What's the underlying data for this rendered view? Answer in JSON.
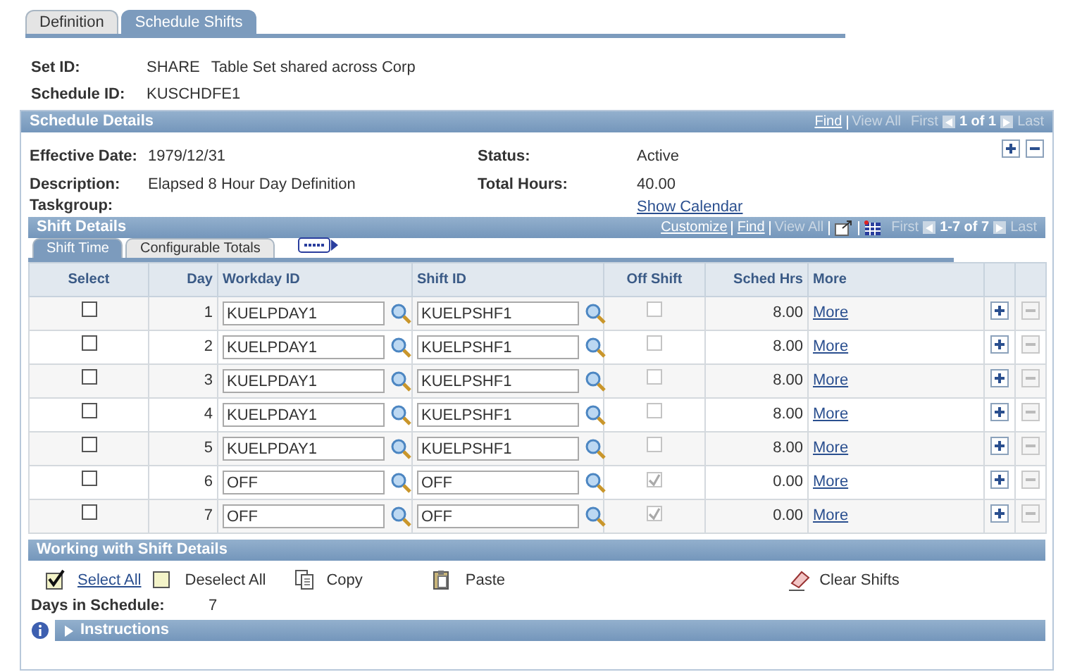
{
  "tabs": [
    {
      "label": "Definition",
      "selected": false
    },
    {
      "label": "Schedule Shifts",
      "selected": true
    }
  ],
  "header": [
    {
      "label": "Set ID:",
      "value": "SHARE",
      "description": "Table Set shared across Corp"
    },
    {
      "label": "Schedule ID:",
      "value": "KUSCHDFE1"
    }
  ],
  "schedule_details": {
    "title": "Schedule Details",
    "nav": {
      "find": "Find",
      "view_all": "View All",
      "first": "First",
      "range": "1 of 1",
      "last": "Last"
    },
    "left_fields": [
      {
        "label": "Effective Date:",
        "value": "1979/12/31"
      },
      {
        "label": "Description:",
        "value": "Elapsed 8 Hour Day Definition"
      },
      {
        "label": "Taskgroup:"
      }
    ],
    "right_fields": [
      {
        "label": "Status:",
        "value": "Active"
      },
      {
        "label": "Total Hours:",
        "value": "40.00"
      }
    ],
    "show_calendar": "Show Calendar"
  },
  "shift_details": {
    "title": "Shift Details",
    "nav": {
      "customize": "Customize",
      "find": "Find",
      "view_all": "View All",
      "first": "First",
      "range": "1-7 of 7",
      "last": "Last"
    },
    "subtabs": [
      {
        "label": "Shift Time",
        "selected": true
      },
      {
        "label": "Configurable Totals",
        "selected": false
      }
    ],
    "columns": [
      "Select",
      "Day",
      "Workday ID",
      "Shift ID",
      "Off Shift",
      "Sched Hrs",
      "More"
    ],
    "rows": [
      {
        "checked": false,
        "day": "1",
        "workday_id": "KUELPDAY1",
        "shift_id": "KUELPSHF1",
        "off_shift": false,
        "off_shift_disabled": true,
        "sched_hrs": "8.00",
        "more": "More",
        "delete_disabled": true
      },
      {
        "checked": false,
        "day": "2",
        "workday_id": "KUELPDAY1",
        "shift_id": "KUELPSHF1",
        "off_shift": false,
        "off_shift_disabled": true,
        "sched_hrs": "8.00",
        "more": "More",
        "delete_disabled": true
      },
      {
        "checked": false,
        "day": "3",
        "workday_id": "KUELPDAY1",
        "shift_id": "KUELPSHF1",
        "off_shift": false,
        "off_shift_disabled": true,
        "sched_hrs": "8.00",
        "more": "More",
        "delete_disabled": true
      },
      {
        "checked": false,
        "day": "4",
        "workday_id": "KUELPDAY1",
        "shift_id": "KUELPSHF1",
        "off_shift": false,
        "off_shift_disabled": true,
        "sched_hrs": "8.00",
        "more": "More",
        "delete_disabled": true
      },
      {
        "checked": false,
        "day": "5",
        "workday_id": "KUELPDAY1",
        "shift_id": "KUELPSHF1",
        "off_shift": false,
        "off_shift_disabled": true,
        "sched_hrs": "8.00",
        "more": "More",
        "delete_disabled": true
      },
      {
        "checked": false,
        "day": "6",
        "workday_id": "OFF",
        "shift_id": "OFF",
        "off_shift": true,
        "off_shift_disabled": true,
        "sched_hrs": "0.00",
        "more": "More",
        "delete_disabled": true
      },
      {
        "checked": false,
        "day": "7",
        "workday_id": "OFF",
        "shift_id": "OFF",
        "off_shift": true,
        "off_shift_disabled": true,
        "sched_hrs": "0.00",
        "more": "More",
        "delete_disabled": true
      }
    ]
  },
  "working": {
    "title": "Working with Shift Details",
    "actions": [
      {
        "kind": "select",
        "label": "Select All",
        "link": true
      },
      {
        "kind": "deselect",
        "label": "Deselect All",
        "link": false
      },
      {
        "kind": "copy",
        "label": "Copy",
        "link": false
      },
      {
        "kind": "paste",
        "label": "Paste",
        "link": false
      },
      {
        "kind": "clear",
        "label": "Clear Shifts",
        "link": false
      }
    ],
    "days_label": "Days in Schedule:",
    "days_value": "7"
  },
  "instructions": {
    "title": "Instructions",
    "expanded": false
  }
}
